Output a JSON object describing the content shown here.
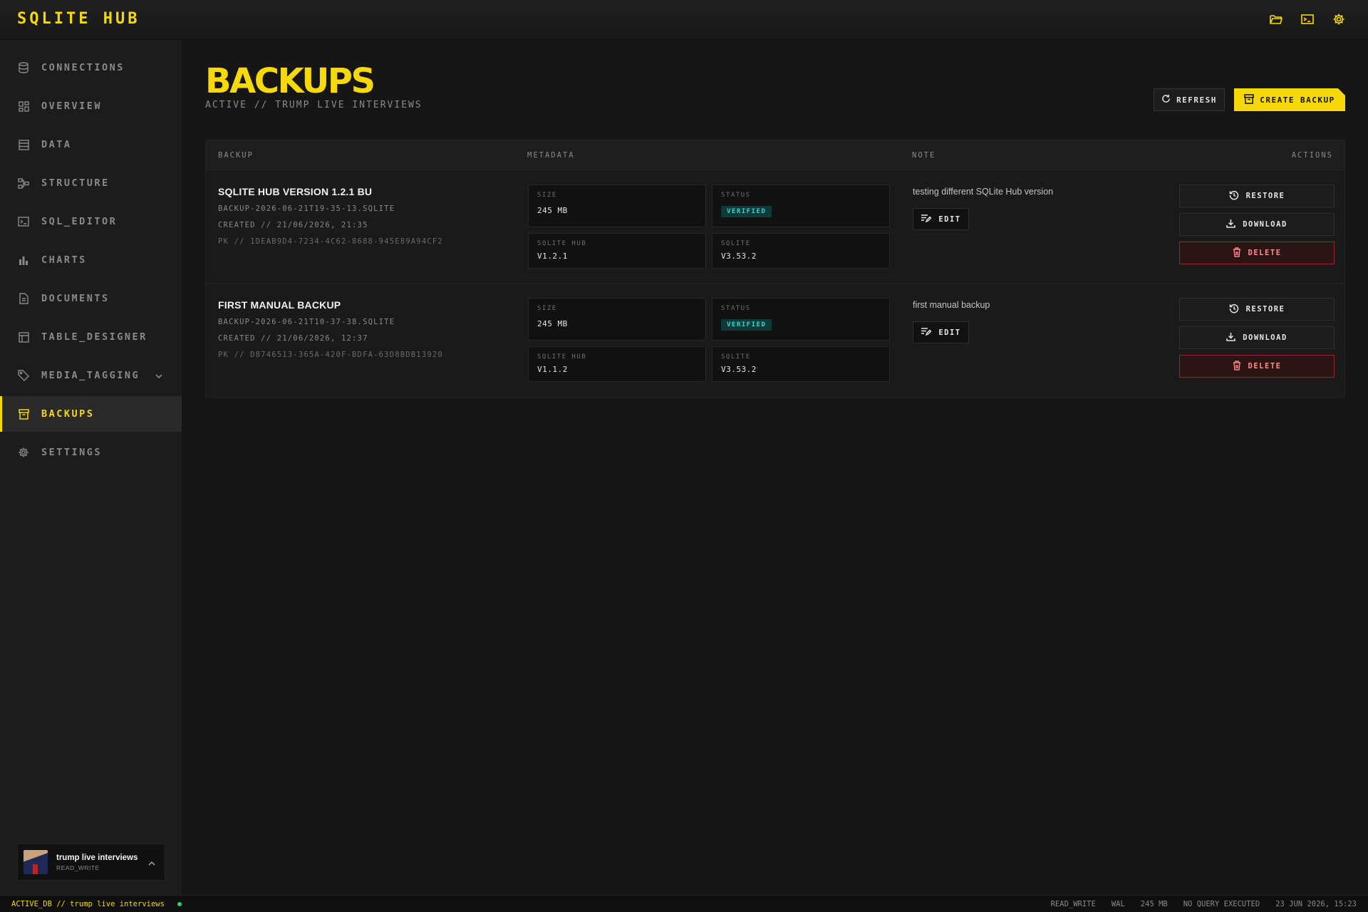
{
  "app": {
    "brand": "SQLITE HUB"
  },
  "topbar": {
    "icons": [
      "folder-open-icon",
      "terminal-icon",
      "gear-icon"
    ]
  },
  "sidebar": {
    "items": [
      {
        "label": "CONNECTIONS",
        "icon": "database-icon"
      },
      {
        "label": "OVERVIEW",
        "icon": "grid-icon"
      },
      {
        "label": "DATA",
        "icon": "table-icon"
      },
      {
        "label": "STRUCTURE",
        "icon": "structure-icon"
      },
      {
        "label": "SQL_EDITOR",
        "icon": "terminal-icon"
      },
      {
        "label": "CHARTS",
        "icon": "bar-chart-icon"
      },
      {
        "label": "DOCUMENTS",
        "icon": "document-icon"
      },
      {
        "label": "TABLE_DESIGNER",
        "icon": "table-designer-icon"
      },
      {
        "label": "MEDIA_TAGGING",
        "icon": "tag-icon"
      },
      {
        "label": "BACKUPS",
        "icon": "archive-icon",
        "active": true
      },
      {
        "label": "SETTINGS",
        "icon": "gear-icon"
      }
    ],
    "db": {
      "name": "trump live interviews",
      "mode": "READ_WRITE"
    }
  },
  "header": {
    "title": "BACKUPS",
    "subtitle": "ACTIVE // TRUMP LIVE INTERVIEWS",
    "refresh_label": "REFRESH",
    "create_label": "CREATE BACKUP"
  },
  "table": {
    "columns": {
      "backup": "BACKUP",
      "metadata": "METADATA",
      "note": "NOTE",
      "actions": "ACTIONS"
    },
    "rows": [
      {
        "title": "SQLITE HUB VERSION 1.2.1 BU",
        "file": "BACKUP-2026-06-21T19-35-13.SQLITE",
        "created": "CREATED // 21/06/2026, 21:35",
        "pk": "PK // 1DEAB9D4-7234-4C62-8688-945E89A94CF2",
        "size_label": "SIZE",
        "size": "245 MB",
        "status_label": "STATUS",
        "status": "VERIFIED",
        "hub_label": "SQLITE HUB",
        "hub": "V1.2.1",
        "sqlite_label": "SQLITE",
        "sqlite": "V3.53.2",
        "note": "testing different SQLite Hub version",
        "edit": "EDIT",
        "restore": "RESTORE",
        "download": "DOWNLOAD",
        "delete": "DELETE"
      },
      {
        "title": "FIRST MANUAL BACKUP",
        "file": "BACKUP-2026-06-21T10-37-38.SQLITE",
        "created": "CREATED // 21/06/2026, 12:37",
        "pk": "PK // D8746513-365A-420F-BDFA-63D8BDB13920",
        "size_label": "SIZE",
        "size": "245 MB",
        "status_label": "STATUS",
        "status": "VERIFIED",
        "hub_label": "SQLITE HUB",
        "hub": "V1.1.2",
        "sqlite_label": "SQLITE",
        "sqlite": "V3.53.2",
        "note": "first manual backup",
        "edit": "EDIT",
        "restore": "RESTORE",
        "download": "DOWNLOAD",
        "delete": "DELETE"
      }
    ]
  },
  "statusbar": {
    "active_db": "ACTIVE_DB // trump live interviews",
    "mode": "READ_WRITE",
    "journal": "WAL",
    "size": "245 MB",
    "query": "NO QUERY EXECUTED",
    "datetime": "23 JUN 2026, 15:23"
  },
  "colors": {
    "accent": "#f5d90a",
    "verified": "#2fd8d0",
    "danger": "#ff8a8a",
    "online": "#25d366"
  }
}
